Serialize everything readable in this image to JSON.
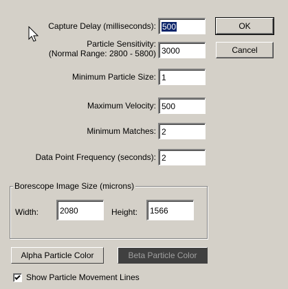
{
  "fields": {
    "capture_delay": {
      "label": "Capture Delay (milliseconds):",
      "value": "500"
    },
    "particle_sensitivity": {
      "label_line1": "Particle Sensitivity:",
      "label_line2": "(Normal Range: 2800 - 5800)",
      "value": "3000"
    },
    "min_particle_size": {
      "label": "Minimum Particle Size:",
      "value": "1"
    },
    "max_velocity": {
      "label": "Maximum Velocity:",
      "value": "500"
    },
    "min_matches": {
      "label": "Minimum Matches:",
      "value": "2"
    },
    "data_point_frequency": {
      "label": "Data Point Frequency (seconds):",
      "value": "2"
    }
  },
  "buttons": {
    "ok": "OK",
    "cancel": "Cancel"
  },
  "image_size_group": {
    "title": "Borescope Image Size (microns)",
    "width_label": "Width:",
    "width_value": "2080",
    "height_label": "Height:",
    "height_value": "1566"
  },
  "color_buttons": {
    "alpha": {
      "label": "Alpha Particle Color",
      "bg": "#d4d0c8",
      "fg": "#000000"
    },
    "beta": {
      "label": "Beta Particle Color",
      "bg": "#404040",
      "fg": "#a0a0a0"
    }
  },
  "checkbox": {
    "label": "Show Particle Movement Lines",
    "checked": true
  }
}
